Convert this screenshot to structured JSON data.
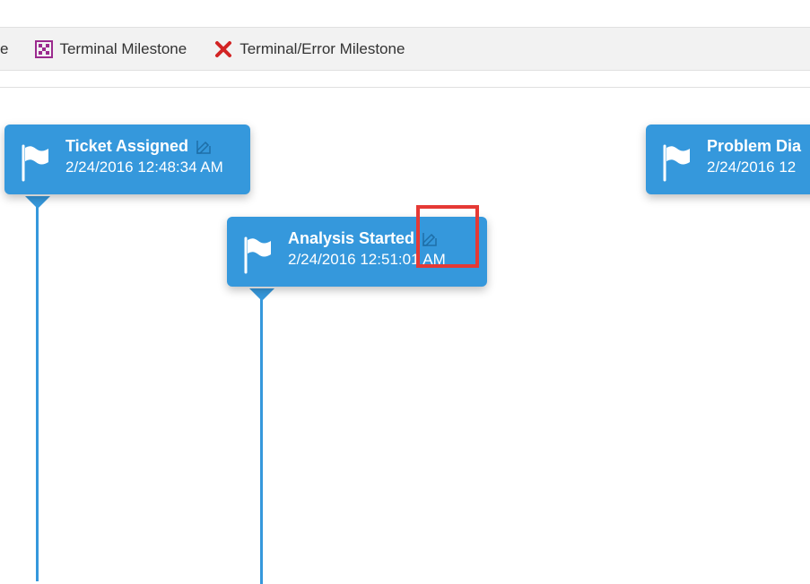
{
  "legend": {
    "partial_text": "e",
    "terminal_milestone": "Terminal Milestone",
    "terminal_error_milestone": "Terminal/Error Milestone"
  },
  "milestones": [
    {
      "title": "Ticket Assigned",
      "timestamp": "2/24/2016 12:48:34 AM"
    },
    {
      "title": "Analysis Started",
      "timestamp": "2/24/2016 12:51:01 AM"
    },
    {
      "title": "Problem Dia",
      "timestamp": "2/24/2016 12"
    }
  ]
}
